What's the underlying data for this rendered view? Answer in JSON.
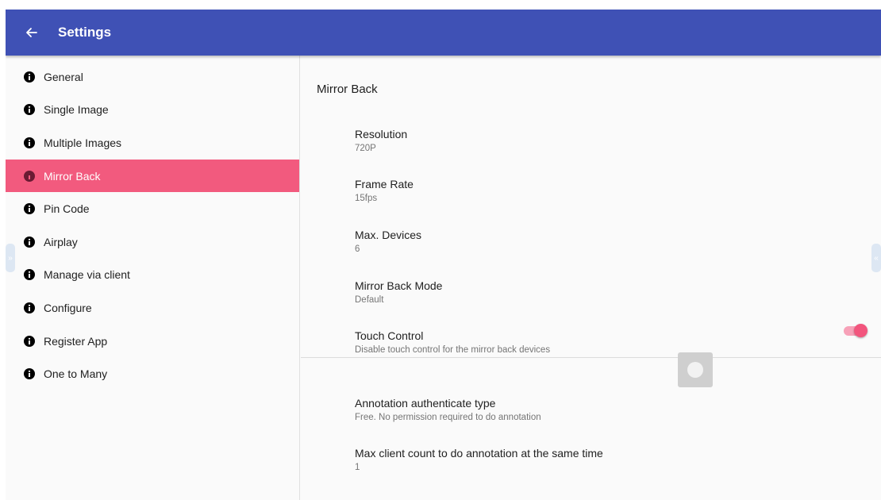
{
  "header": {
    "title": "Settings",
    "back_icon": "arrow-left-icon",
    "color": "#3f51b5"
  },
  "sidebar": {
    "items": [
      {
        "label": "General",
        "icon": "info-icon"
      },
      {
        "label": "Single Image",
        "icon": "info-icon"
      },
      {
        "label": "Multiple Images",
        "icon": "info-icon"
      },
      {
        "label": "Mirror Back",
        "icon": "info-icon",
        "active": true
      },
      {
        "label": "Pin Code",
        "icon": "info-icon"
      },
      {
        "label": "Airplay",
        "icon": "info-icon"
      },
      {
        "label": "Manage via client",
        "icon": "info-icon"
      },
      {
        "label": "Configure",
        "icon": "info-icon"
      },
      {
        "label": "Register App",
        "icon": "info-icon"
      },
      {
        "label": "One to Many",
        "icon": "info-icon"
      }
    ],
    "active_color": "#f25a7e"
  },
  "main": {
    "section_title": "Mirror Back",
    "preferences": [
      {
        "title": "Resolution",
        "summary": "720P"
      },
      {
        "title": "Frame Rate",
        "summary": "15fps"
      },
      {
        "title": "Max. Devices",
        "summary": "6"
      },
      {
        "title": "Mirror Back Mode",
        "summary": "Default"
      },
      {
        "title": "Touch Control",
        "summary": "Disable touch control for the mirror back devices",
        "toggle_on": true
      },
      {
        "title": "Annotation authenticate type",
        "summary": "Free. No permission required to do annotation"
      },
      {
        "title": "Max client count to do annotation at the same time",
        "summary": "1"
      }
    ],
    "accent_color": "#f2557d"
  },
  "edge_tabs": {
    "left_icon": "chevron-double-right-icon",
    "right_icon": "chevron-double-left-icon"
  },
  "floating_button": {
    "icon": "circle-dot-icon"
  }
}
